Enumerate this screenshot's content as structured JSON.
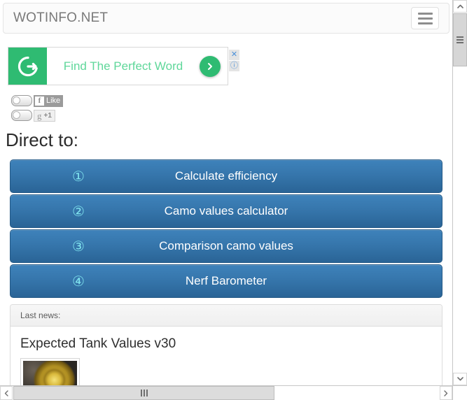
{
  "browser": {
    "vertical_scrollbar": {
      "up_arrow_icon": "chevron-up-icon",
      "down_arrow_icon": "chevron-down-icon",
      "grip_icon": "grip-lines-icon"
    },
    "horizontal_scrollbar": {
      "left_arrow_icon": "chevron-left-icon",
      "right_arrow_icon": "chevron-right-icon",
      "grip_icon": "grip-lines-vertical-icon"
    }
  },
  "navbar": {
    "brand": "WOTINFO.NET",
    "menu_icon": "hamburger-menu-icon"
  },
  "ad": {
    "logo_letter": "G",
    "logo_icon": "grammarly-g-icon",
    "headline": "Find The Perfect Word",
    "cta_icon": "chevron-right-icon",
    "close_icon": "close-x-icon",
    "close_label": "✕",
    "info_icon": "ad-info-icon",
    "info_label": "ⓘ",
    "accent_color": "#2fbb72",
    "text_color": "#5fd79a"
  },
  "social": {
    "facebook": {
      "toggle_icon": "toggle-switch-icon",
      "badge": "f",
      "label": "Like"
    },
    "google": {
      "toggle_icon": "toggle-switch-icon",
      "badge": "g",
      "label": "+1"
    }
  },
  "direct": {
    "title": "Direct to:",
    "buttons": [
      {
        "number": "①",
        "label": "Calculate efficiency"
      },
      {
        "number": "②",
        "label": "Camo values calculator"
      },
      {
        "number": "③",
        "label": "Comparison camo values"
      },
      {
        "number": "④",
        "label": "Nerf Barometer"
      }
    ],
    "button_color_top": "#3e82ba",
    "button_color_bottom": "#2a6496",
    "number_color": "#7fe3ee"
  },
  "news": {
    "header": "Last news:",
    "items": [
      {
        "title": "Expected Tank Values v30",
        "thumbnail_icon": "tank-sprocket-wheel-thumbnail"
      }
    ]
  }
}
